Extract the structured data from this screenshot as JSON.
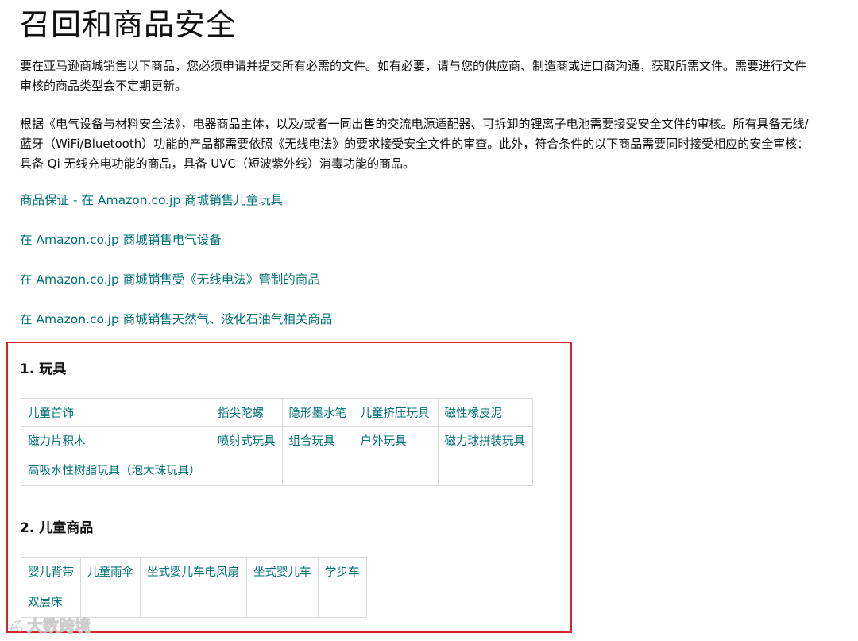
{
  "page": {
    "title": "召回和商品安全",
    "paragraph1": "要在亚马逊商城销售以下商品，您必须申请并提交所有必需的文件。如有必要，请与您的供应商、制造商或进口商沟通，获取所需文件。需要进行文件审核的商品类型会不定期更新。",
    "paragraph2": "根据《电气设备与材料安全法》，电器商品主体，以及/或者一同出售的交流电源适配器、可拆卸的锂离子电池需要接受安全文件的审核。所有具备无线/蓝牙（WiFi/Bluetooth）功能的产品都需要依照《无线电法》的要求接受安全文件的审查。此外，符合条件的以下商品需要同时接受相应的安全审核：具备 Qi 无线充电功能的商品，具备 UVC（短波紫外线）消毒功能的商品。"
  },
  "links": [
    "商品保证 - 在 Amazon.co.jp 商城销售儿童玩具",
    "在 Amazon.co.jp 商城销售电气设备",
    "在 Amazon.co.jp 商城销售受《无线电法》管制的商品",
    "在 Amazon.co.jp 商城销售天然气、液化石油气相关商品"
  ],
  "sections": {
    "toys": {
      "heading": "1. 玩具",
      "rows": [
        [
          "儿童首饰",
          "指尖陀螺",
          "隐形墨水笔",
          "儿童挤压玩具",
          "磁性橡皮泥"
        ],
        [
          "磁力片积木",
          "喷射式玩具",
          "组合玩具",
          "户外玩具",
          "磁力球拼装玩具"
        ],
        [
          "高吸水性树脂玩具（泡大珠玩具）",
          "",
          "",
          "",
          ""
        ]
      ]
    },
    "kids": {
      "heading": "2. 儿童商品",
      "rows": [
        [
          "婴儿背带",
          "儿童雨伞",
          "坐式婴儿车电风扇",
          "坐式婴儿车",
          "学步车"
        ],
        [
          "双层床",
          "",
          "",
          "",
          ""
        ]
      ]
    }
  },
  "watermark": {
    "text": "大数跨境",
    "icon": "brand-logo-icon"
  },
  "colors": {
    "link": "#00727a",
    "highlight_border": "#d0272e",
    "table_border": "#d5d9d9"
  }
}
